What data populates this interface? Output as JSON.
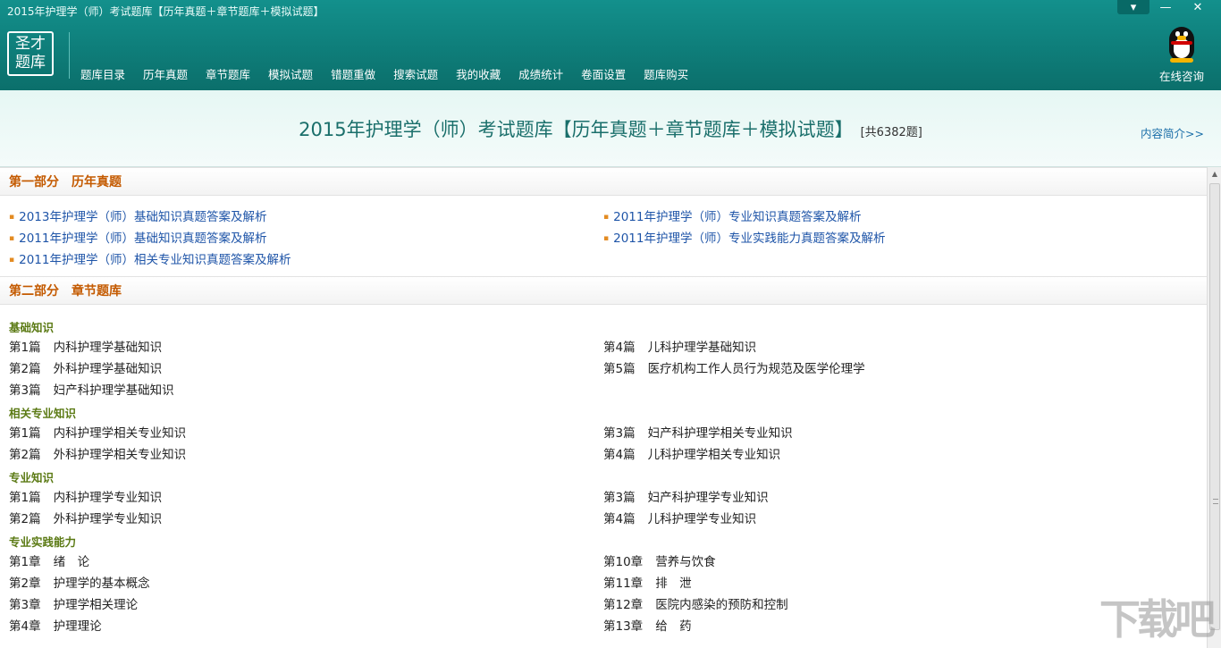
{
  "window": {
    "title": "2015年护理学（师）考试题库【历年真题＋章节题库＋模拟试题】",
    "controls": [
      "▾",
      "—",
      "✕"
    ]
  },
  "logo": {
    "line1": "圣才",
    "line2": "题库"
  },
  "nav": [
    "题库目录",
    "历年真题",
    "章节题库",
    "模拟试题",
    "错题重做",
    "搜索试题",
    "我的收藏",
    "成绩统计",
    "卷面设置",
    "题库购买"
  ],
  "consult": {
    "label": "在线咨询",
    "icon": "qq-penguin-icon"
  },
  "banner": {
    "title": "2015年护理学（师）考试题库【历年真题＋章节题库＋模拟试题】",
    "count": "[共6382题]",
    "intro_link": "内容简介>>"
  },
  "section1": {
    "part": "第一部分",
    "name": "历年真题",
    "links": [
      "2013年护理学（师）基础知识真题答案及解析",
      "2011年护理学（师）专业知识真题答案及解析",
      "2011年护理学（师）基础知识真题答案及解析",
      "2011年护理学（师）专业实践能力真题答案及解析",
      "2011年护理学（师）相关专业知识真题答案及解析"
    ]
  },
  "section2": {
    "part": "第二部分",
    "name": "章节题库",
    "groups": [
      {
        "title": "基础知识",
        "items": [
          {
            "num": "第1篇",
            "name": "内科护理学基础知识"
          },
          {
            "num": "第4篇",
            "name": "儿科护理学基础知识"
          },
          {
            "num": "第2篇",
            "name": "外科护理学基础知识"
          },
          {
            "num": "第5篇",
            "name": "医疗机构工作人员行为规范及医学伦理学"
          },
          {
            "num": "第3篇",
            "name": "妇产科护理学基础知识"
          }
        ]
      },
      {
        "title": "相关专业知识",
        "items": [
          {
            "num": "第1篇",
            "name": "内科护理学相关专业知识"
          },
          {
            "num": "第3篇",
            "name": "妇产科护理学相关专业知识"
          },
          {
            "num": "第2篇",
            "name": "外科护理学相关专业知识"
          },
          {
            "num": "第4篇",
            "name": "儿科护理学相关专业知识"
          }
        ]
      },
      {
        "title": "专业知识",
        "items": [
          {
            "num": "第1篇",
            "name": "内科护理学专业知识"
          },
          {
            "num": "第3篇",
            "name": "妇产科护理学专业知识"
          },
          {
            "num": "第2篇",
            "name": "外科护理学专业知识"
          },
          {
            "num": "第4篇",
            "name": "儿科护理学专业知识"
          }
        ]
      },
      {
        "title": "专业实践能力",
        "items": [
          {
            "num": "第1章",
            "name": "绪　论"
          },
          {
            "num": "第10章",
            "name": "营养与饮食"
          },
          {
            "num": "第2章",
            "name": "护理学的基本概念"
          },
          {
            "num": "第11章",
            "name": "排　泄"
          },
          {
            "num": "第3章",
            "name": "护理学相关理论"
          },
          {
            "num": "第12章",
            "name": "医院内感染的预防和控制"
          },
          {
            "num": "第4章",
            "name": "护理理论"
          },
          {
            "num": "第13章",
            "name": "给　药"
          }
        ]
      }
    ]
  },
  "watermark": "下载吧"
}
